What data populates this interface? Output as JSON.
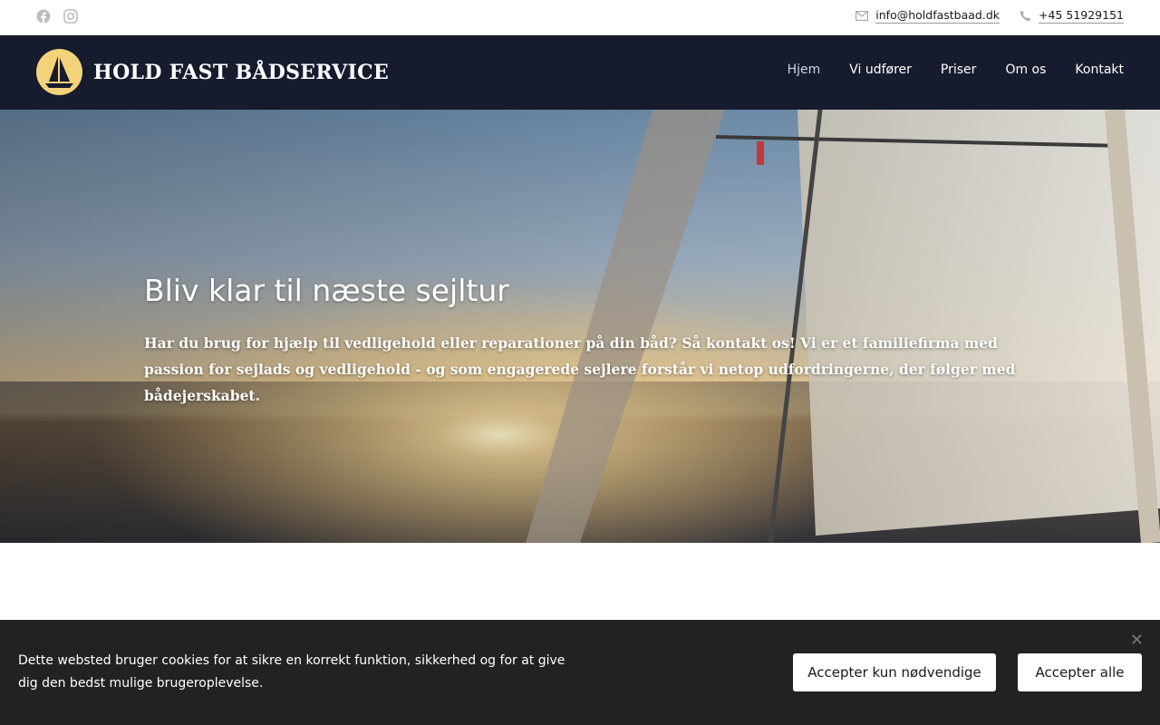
{
  "topbar": {
    "social": [
      "facebook-icon",
      "instagram-icon"
    ],
    "email_icon": "mail-icon",
    "email": "info@holdfastbaad.dk",
    "phone_icon": "phone-icon",
    "phone": "+45 51929151"
  },
  "header": {
    "brand": "HOLD FAST BÅDSERVICE",
    "logo_icon": "sailboat-logo-icon",
    "nav": [
      {
        "label": "Hjem",
        "active": true
      },
      {
        "label": "Vi udfører",
        "active": false
      },
      {
        "label": "Priser",
        "active": false
      },
      {
        "label": "Om os",
        "active": false
      },
      {
        "label": "Kontakt",
        "active": false
      }
    ]
  },
  "hero": {
    "title": "Bliv klar til næste sejltur",
    "text": "Har du brug for hjælp til vedligehold eller reparationer på din båd? Så kontakt os! Vi er et familiefirma med passion for sejlads og vedligehold - og som engagerede sejlere forstår vi netop udfordringerne, der følger med bådejerskabet."
  },
  "cookie": {
    "text": "Dette websted bruger cookies for at sikre en korrekt funktion, sikkerhed og for at give dig den bedst mulige brugeroplevelse.",
    "close_icon": "close-icon",
    "btn_necessary": "Accepter kun nødvendige",
    "btn_all": "Accepter alle"
  },
  "colors": {
    "header_bg": "#161c2e",
    "logo_bg": "#f3d27a",
    "cookie_bg": "#222222"
  }
}
